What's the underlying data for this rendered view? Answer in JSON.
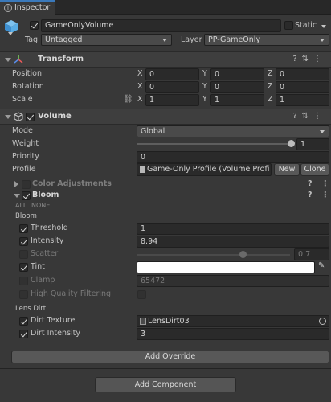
{
  "tab": {
    "label": "Inspector"
  },
  "header": {
    "object_name": "GameOnlyVolume",
    "static_label": "Static",
    "tag_label": "Tag",
    "tag_value": "Untagged",
    "layer_label": "Layer",
    "layer_value": "PP-GameOnly"
  },
  "transform": {
    "title": "Transform",
    "position": {
      "label": "Position",
      "x": "0",
      "y": "0",
      "z": "0"
    },
    "rotation": {
      "label": "Rotation",
      "x": "0",
      "y": "0",
      "z": "0"
    },
    "scale": {
      "label": "Scale",
      "x": "1",
      "y": "1",
      "z": "1"
    },
    "axis": {
      "x": "X",
      "y": "Y",
      "z": "Z"
    }
  },
  "volume": {
    "title": "Volume",
    "mode_label": "Mode",
    "mode_value": "Global",
    "weight_label": "Weight",
    "weight_value": "1",
    "priority_label": "Priority",
    "priority_value": "0",
    "profile_label": "Profile",
    "profile_value": "Game-Only Profile (Volume Profi",
    "new_label": "New",
    "clone_label": "Clone"
  },
  "color_adjustments": {
    "title": "Color Adjustments"
  },
  "bloom": {
    "title": "Bloom",
    "all_label": "ALL",
    "none_label": "NONE",
    "section_bloom": "Bloom",
    "threshold": {
      "label": "Threshold",
      "value": "1"
    },
    "intensity": {
      "label": "Intensity",
      "value": "8.94"
    },
    "scatter": {
      "label": "Scatter",
      "value": "0.7"
    },
    "tint": {
      "label": "Tint",
      "color": "#ffffff"
    },
    "clamp": {
      "label": "Clamp",
      "value": "65472"
    },
    "hq_filtering": {
      "label": "High Quality Filtering"
    },
    "section_lens_dirt": "Lens Dirt",
    "dirt_texture": {
      "label": "Dirt Texture",
      "value": "LensDirt03"
    },
    "dirt_intensity": {
      "label": "Dirt Intensity",
      "value": "3"
    }
  },
  "add_override_label": "Add Override",
  "add_component_label": "Add Component"
}
